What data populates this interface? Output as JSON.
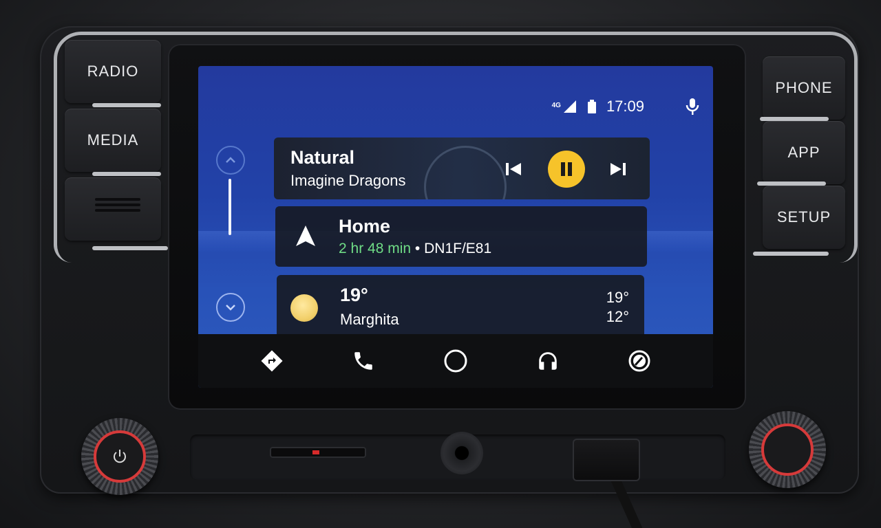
{
  "hardware": {
    "left_buttons": [
      {
        "label": "RADIO"
      },
      {
        "label": "MEDIA"
      }
    ],
    "right_buttons": [
      {
        "label": "PHONE"
      },
      {
        "label": "APP"
      },
      {
        "label": "SETUP"
      }
    ]
  },
  "status_bar": {
    "network": "4G",
    "time": "17:09",
    "mic_icon": "microphone-icon"
  },
  "music_card": {
    "title": "Natural",
    "artist": "Imagine Dragons",
    "state": "playing",
    "controls": [
      "skip-previous-icon",
      "pause-icon",
      "skip-next-icon"
    ]
  },
  "nav_card": {
    "destination": "Home",
    "eta": "2 hr 48 min",
    "separator": "•",
    "road": "DN1F/E81"
  },
  "weather_card": {
    "temperature": "19°",
    "location": "Marghita",
    "high": "19°",
    "low": "12°"
  },
  "bottom_bar": {
    "items": [
      "navigation-icon",
      "phone-icon",
      "home-icon",
      "headphones-icon",
      "exit-icon"
    ]
  },
  "colors": {
    "accent_pause": "#f6c32a",
    "eta_green": "#6fdc86",
    "knob_ring": "#d63a3a"
  }
}
